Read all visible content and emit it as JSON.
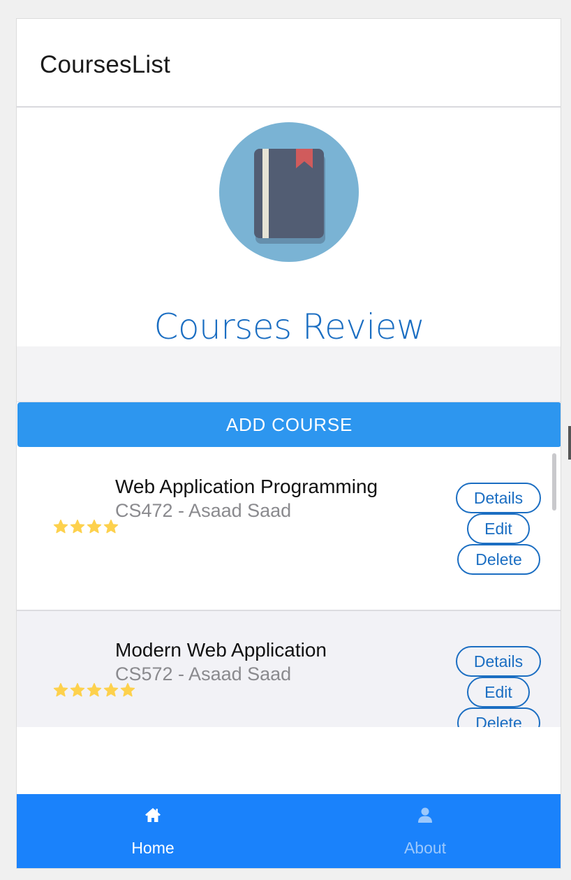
{
  "header": {
    "title": "CoursesList"
  },
  "hero": {
    "title": "Courses Review",
    "logo_icon": "book-icon"
  },
  "add_button": {
    "label": "ADD COURSE"
  },
  "courses": [
    {
      "name": "Web Application Programming",
      "subtitle": "CS472 - Asaad Saad",
      "rating": 4,
      "details_label": "Details",
      "edit_label": "Edit",
      "delete_label": "Delete"
    },
    {
      "name": "Modern Web Application",
      "subtitle": "CS572 - Asaad Saad",
      "rating": 5,
      "details_label": "Details",
      "edit_label": "Edit",
      "delete_label": "Delete"
    }
  ],
  "tabs": [
    {
      "label": "Home",
      "icon": "home-icon",
      "active": true
    },
    {
      "label": "About",
      "icon": "person-icon",
      "active": false
    }
  ],
  "colors": {
    "accent": "#1b6ec2",
    "add_button": "#2d96ef",
    "tabbar": "#1a82fb",
    "star": "#fdd14d",
    "logo_bg": "#7ab3d4"
  }
}
